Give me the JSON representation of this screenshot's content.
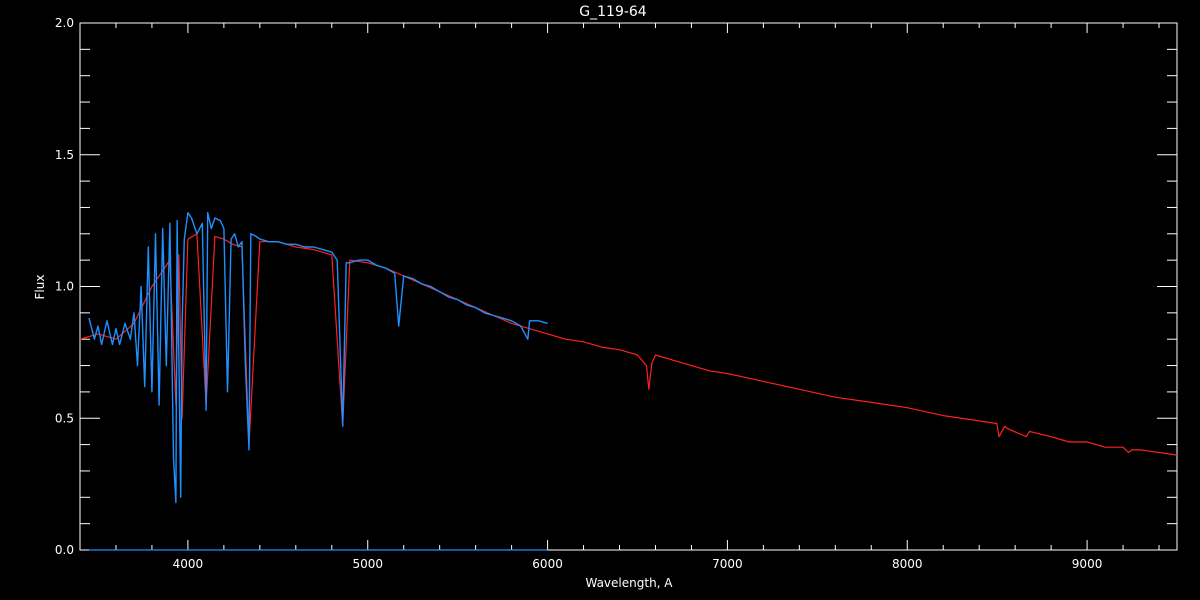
{
  "chart_data": {
    "type": "line",
    "title": "G_119-64",
    "xlabel": "Wavelength, A",
    "ylabel": "Flux",
    "xlim": [
      3400,
      9500
    ],
    "ylim": [
      0.0,
      2.0
    ],
    "x_ticks": [
      4000,
      5000,
      6000,
      7000,
      8000,
      9000
    ],
    "x_tick_labels": [
      "4000",
      "5000",
      "6000",
      "7000",
      "8000",
      "9000"
    ],
    "y_ticks": [
      0.0,
      0.5,
      1.0,
      1.5,
      2.0
    ],
    "y_tick_labels": [
      "0.0",
      "0.5",
      "1.0",
      "1.5",
      "2.0"
    ],
    "grid": false,
    "colors": {
      "background": "#000000",
      "axes": "#ffffff",
      "observed": "#1e90ff",
      "model": "#ff2020"
    },
    "series": [
      {
        "color": "#ff2020",
        "x": [
          3400,
          3500,
          3600,
          3700,
          3800,
          3850,
          3900,
          3933,
          3950,
          3968,
          4000,
          4050,
          4101,
          4150,
          4200,
          4250,
          4300,
          4340,
          4400,
          4500,
          4600,
          4700,
          4800,
          4861,
          4900,
          5000,
          5100,
          5200,
          5300,
          5400,
          5500,
          5600,
          5700,
          5800,
          5900,
          6000,
          6100,
          6200,
          6300,
          6400,
          6500,
          6550,
          6563,
          6580,
          6600,
          6700,
          6800,
          6900,
          7000,
          7200,
          7400,
          7600,
          7800,
          8000,
          8200,
          8400,
          8498,
          8510,
          8542,
          8560,
          8662,
          8680,
          8800,
          8900,
          9000,
          9100,
          9200,
          9230,
          9250,
          9300,
          9400,
          9500
        ],
        "y": [
          0.8,
          0.82,
          0.8,
          0.86,
          1.0,
          1.05,
          1.1,
          0.55,
          1.12,
          0.5,
          1.18,
          1.2,
          0.55,
          1.19,
          1.18,
          1.16,
          1.15,
          0.4,
          1.17,
          1.17,
          1.15,
          1.14,
          1.12,
          0.47,
          1.1,
          1.09,
          1.07,
          1.04,
          1.01,
          0.98,
          0.95,
          0.92,
          0.89,
          0.86,
          0.84,
          0.82,
          0.8,
          0.79,
          0.77,
          0.76,
          0.74,
          0.7,
          0.61,
          0.71,
          0.74,
          0.72,
          0.7,
          0.68,
          0.67,
          0.64,
          0.61,
          0.58,
          0.56,
          0.54,
          0.51,
          0.49,
          0.48,
          0.43,
          0.47,
          0.46,
          0.43,
          0.45,
          0.43,
          0.41,
          0.41,
          0.39,
          0.39,
          0.37,
          0.38,
          0.38,
          0.37,
          0.36
        ]
      },
      {
        "color": "#1e90ff",
        "x": [
          3450,
          3480,
          3500,
          3520,
          3550,
          3580,
          3600,
          3620,
          3650,
          3680,
          3700,
          3720,
          3740,
          3760,
          3780,
          3800,
          3820,
          3840,
          3860,
          3880,
          3900,
          3920,
          3933,
          3940,
          3960,
          3968,
          3980,
          4000,
          4020,
          4050,
          4080,
          4101,
          4110,
          4130,
          4150,
          4180,
          4200,
          4220,
          4240,
          4260,
          4280,
          4300,
          4320,
          4340,
          4350,
          4380,
          4400,
          4450,
          4500,
          4550,
          4600,
          4650,
          4700,
          4750,
          4800,
          4830,
          4861,
          4880,
          4900,
          4950,
          5000,
          5050,
          5100,
          5150,
          5172,
          5200,
          5250,
          5300,
          5350,
          5400,
          5450,
          5500,
          5550,
          5600,
          5650,
          5700,
          5750,
          5800,
          5850,
          5890,
          5900,
          5950,
          6000
        ],
        "y": [
          0.88,
          0.8,
          0.85,
          0.78,
          0.87,
          0.78,
          0.84,
          0.78,
          0.86,
          0.8,
          0.9,
          0.7,
          1.0,
          0.62,
          1.15,
          0.6,
          1.2,
          0.55,
          1.22,
          0.7,
          1.24,
          0.35,
          0.18,
          1.25,
          0.2,
          0.85,
          1.18,
          1.28,
          1.26,
          1.2,
          1.24,
          0.53,
          1.28,
          1.22,
          1.26,
          1.25,
          1.22,
          0.6,
          1.18,
          1.2,
          1.15,
          1.17,
          0.7,
          0.38,
          1.2,
          1.19,
          1.18,
          1.17,
          1.17,
          1.16,
          1.16,
          1.15,
          1.15,
          1.14,
          1.13,
          1.1,
          0.47,
          1.09,
          1.09,
          1.1,
          1.1,
          1.08,
          1.07,
          1.05,
          0.85,
          1.04,
          1.03,
          1.01,
          1.0,
          0.98,
          0.96,
          0.95,
          0.93,
          0.92,
          0.9,
          0.89,
          0.88,
          0.87,
          0.85,
          0.8,
          0.87,
          0.87,
          0.86
        ]
      },
      {
        "color": "#1e90ff",
        "x": [
          3450,
          6000
        ],
        "y": [
          0.0,
          0.0
        ]
      }
    ]
  }
}
